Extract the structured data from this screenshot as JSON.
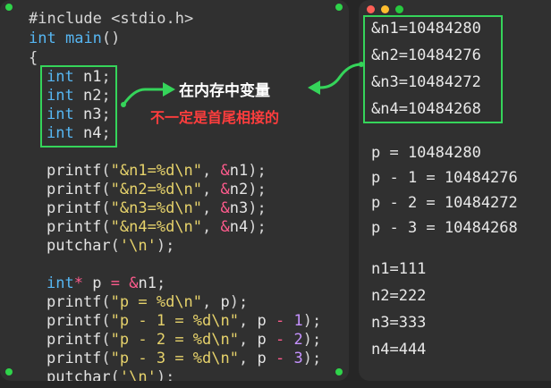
{
  "code_lines": [
    "#include <stdio.h>",
    "int main()",
    "{",
    "int n1;",
    "int n2;",
    "int n3;",
    "int n4;",
    "printf(\"&n1=%d\\n\", &n1);",
    "printf(\"&n2=%d\\n\", &n2);",
    "printf(\"&n3=%d\\n\", &n3);",
    "printf(\"&n4=%d\\n\", &n4);",
    "putchar('\\n');",
    "int* p = &n1;",
    "printf(\"p = %d\\n\", p);",
    "printf(\"p - 1 = %d\\n\", p - 1);",
    "printf(\"p - 2 = %d\\n\", p - 2);",
    "printf(\"p - 3 = %d\\n\", p - 3);",
    "putchar('\\n');"
  ],
  "annotation": {
    "title": "在内存中变量",
    "subtitle": "不一定是首尾相接的"
  },
  "output_lines": [
    "&n1=10484280",
    "&n2=10484276",
    "&n3=10484272",
    "&n4=10484268",
    "p = 10484280",
    "p - 1 = 10484276",
    "p - 2 = 10484272",
    "p - 3 = 10484268",
    "n1=111",
    "n2=222",
    "n3=333",
    "n4=444"
  ],
  "colors": {
    "accent_green": "#35d45a",
    "annotation_red": "#ff3d3d",
    "window_close": "#ff5f56",
    "window_min": "#ffbd2e",
    "window_max": "#27c93f"
  }
}
